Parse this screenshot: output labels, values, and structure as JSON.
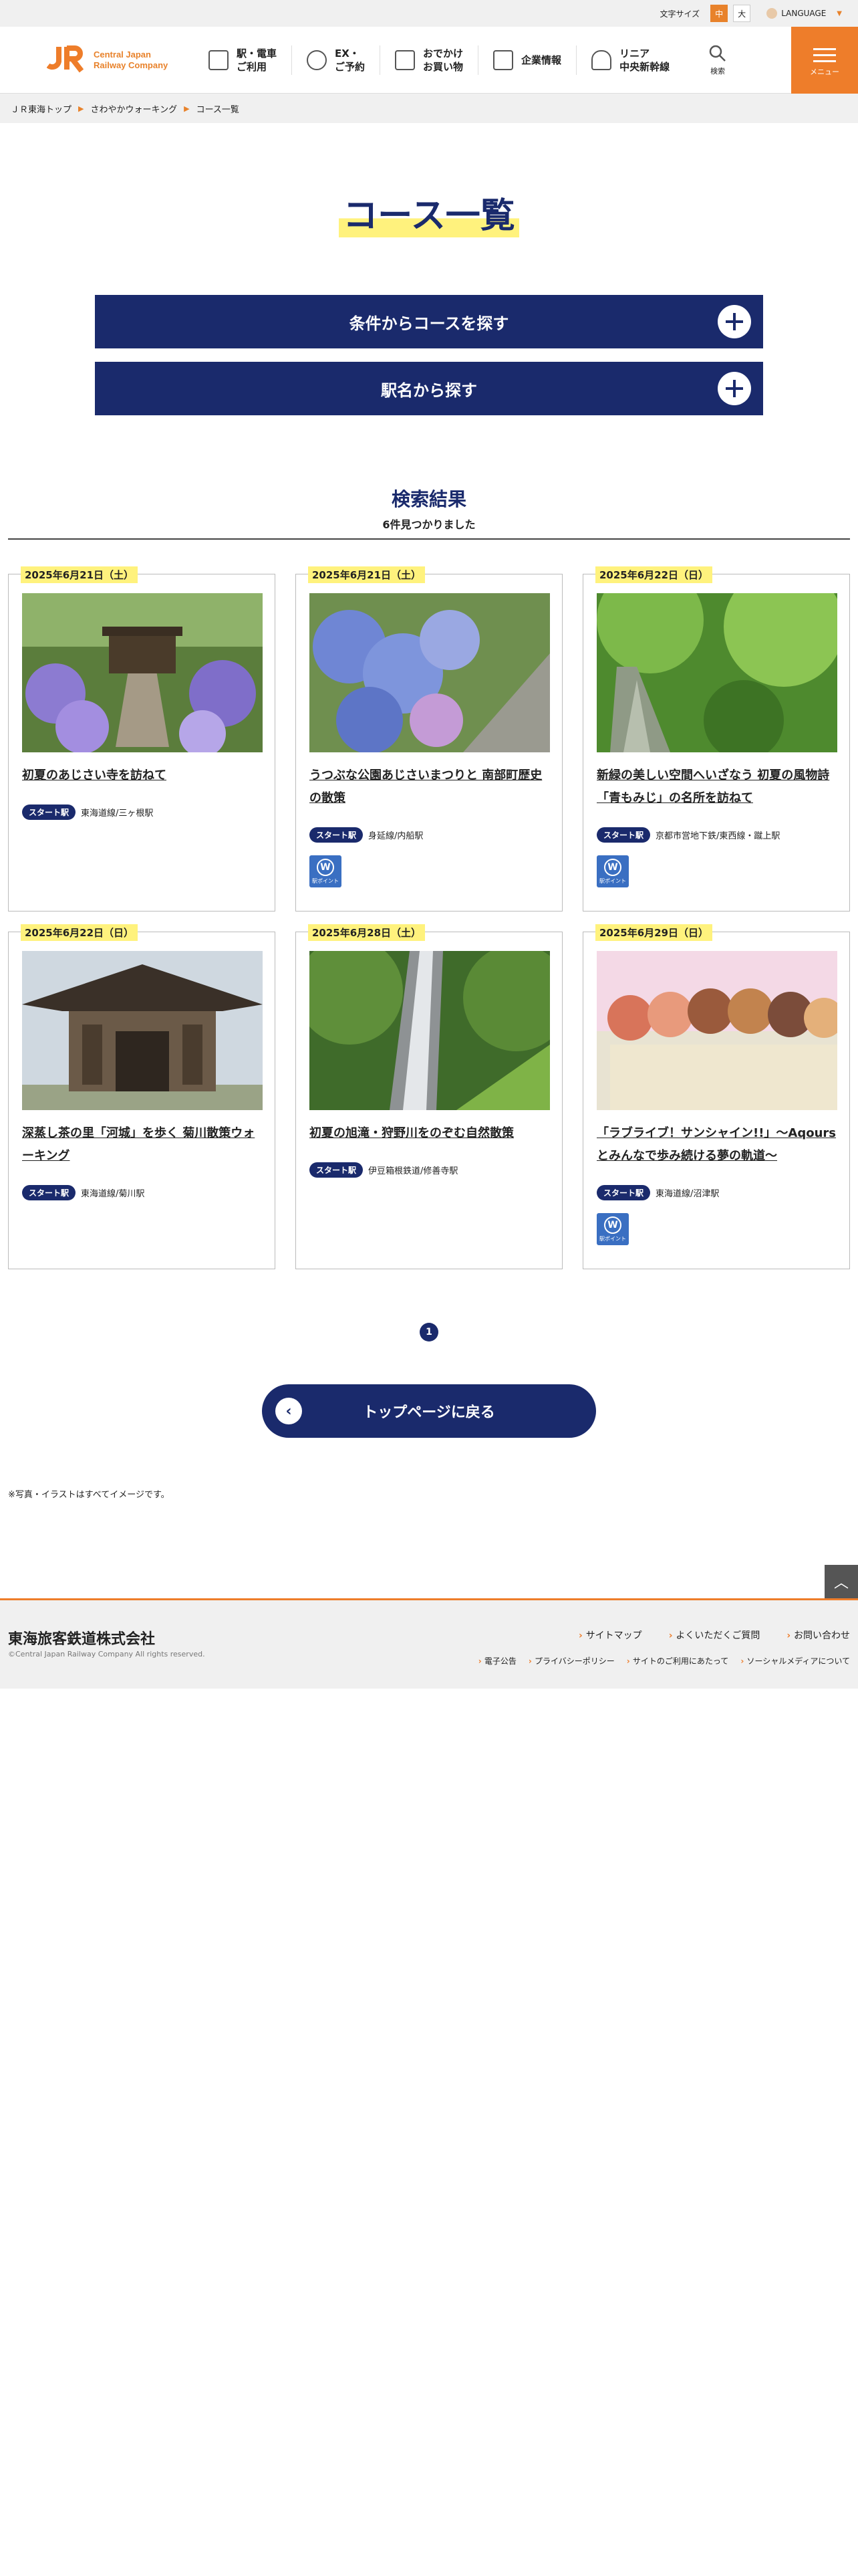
{
  "utility": {
    "font_size_label": "文字サイズ",
    "font_mid": "中",
    "font_large": "大",
    "language": "LANGUAGE"
  },
  "header": {
    "logo_mark": "JR東海",
    "logo_text_1": "Central Japan",
    "logo_text_2": "Railway Company",
    "nav": [
      {
        "line1": "駅・電車",
        "line2": "ご利用"
      },
      {
        "line1": "EX・",
        "line2": "ご予約"
      },
      {
        "line1": "おでかけ",
        "line2": "お買い物"
      },
      {
        "line1": "企業情報",
        "line2": ""
      },
      {
        "line1": "リニア",
        "line2": "中央新幹線"
      }
    ],
    "search_label": "検索",
    "menu_label": "メニュー"
  },
  "breadcrumb": [
    "ＪＲ東海トップ",
    "さわやかウォーキング",
    "コース一覧"
  ],
  "page_title": "コース一覧",
  "accordions": [
    "条件からコースを探す",
    "駅名から探す"
  ],
  "results": {
    "heading": "検索結果",
    "count": "6件見つかりました"
  },
  "start_label": "スタート駅",
  "wpoint_label": "駅ポイント",
  "cards": [
    {
      "date": "2025年6月21日（土）",
      "title": "初夏のあじさい寺を訪ねて",
      "station": "東海道線/三ヶ根駅",
      "wpoint": false
    },
    {
      "date": "2025年6月21日（土）",
      "title": "うつぶな公園あじさいまつりと 南部町歴史の散策",
      "station": "身延線/内船駅",
      "wpoint": true
    },
    {
      "date": "2025年6月22日（日）",
      "title": "新緑の美しい空間へいざなう 初夏の風物詩「青もみじ」の名所を訪ねて",
      "station": "京都市営地下鉄/東西線・蹴上駅",
      "wpoint": true
    },
    {
      "date": "2025年6月22日（日）",
      "title": "深蒸し茶の里「河城」を歩く 菊川散策ウォーキング",
      "station": "東海道線/菊川駅",
      "wpoint": false
    },
    {
      "date": "2025年6月28日（土）",
      "title": "初夏の旭滝・狩野川をのぞむ自然散策",
      "station": "伊豆箱根鉄道/修善寺駅",
      "wpoint": false
    },
    {
      "date": "2025年6月29日（日）",
      "title": "「ラブライブ！サンシャイン!!」～Aqours とみんなで歩み続ける夢の軌道～",
      "station": "東海道線/沼津駅",
      "wpoint": true
    }
  ],
  "pagination": {
    "current": "1"
  },
  "back_button": "トップページに戻る",
  "note": "※写真・イラストはすべてイメージです。",
  "footer": {
    "corp_name": "東海旅客鉄道株式会社",
    "copyright": "©Central Japan Railway Company All rights reserved.",
    "links": [
      "サイトマップ",
      "よくいただくご質問",
      "お問い合わせ"
    ],
    "sublinks": [
      "電子公告",
      "プライバシーポリシー",
      "サイトのご利用にあたって",
      "ソーシャルメディアについて"
    ]
  }
}
